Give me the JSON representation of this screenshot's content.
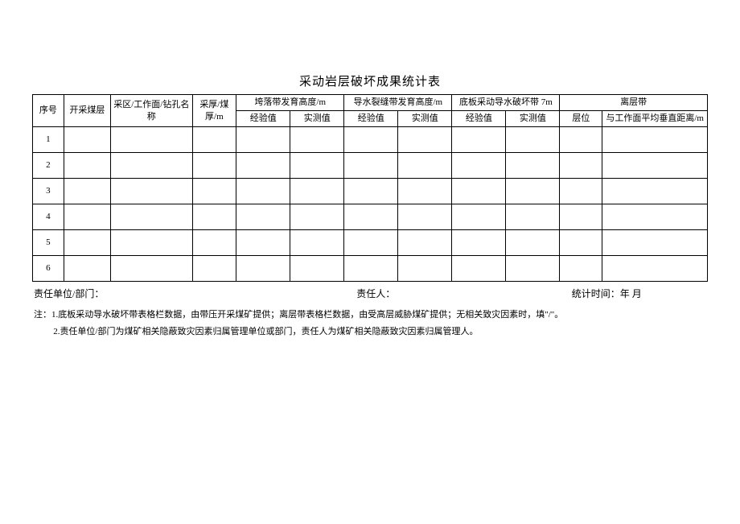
{
  "title": "采动岩层破坏成果统计表",
  "headers": {
    "seq": "序号",
    "seam": "开采煤层",
    "area": "采区/工作面/钻孔名称",
    "thickness": "采厚/煤厚/m",
    "group_kl": "垮落带发育高度/m",
    "group_dsx": "导水裂缝带发育高度/m",
    "group_db": "底板采动导水破坏带 7m",
    "group_lc": "离层带",
    "exp": "经验值",
    "mea": "实测值",
    "cengwei": "层位",
    "dist": "与工作面平均垂直距离/m"
  },
  "rows": [
    "1",
    "2",
    "3",
    "4",
    "5",
    "6"
  ],
  "footer": {
    "unit_label": "责任单位/部门：",
    "person_label": "责任人：",
    "time_label": "统计时间：",
    "time_value": "年 月"
  },
  "notes": {
    "n1": "1.底板采动导水破坏带表格栏数据，由带压开采煤矿提供；离层带表格栏数据，由受高层威胁煤矿提供；无相关致灾因素时，填\"/\"。",
    "n2": "2.责任单位/部门为煤矿相关隐蔽致灾因素归属管理单位或部门，责任人为煤矿相关隐蔽致灾因素归属管理人。"
  }
}
